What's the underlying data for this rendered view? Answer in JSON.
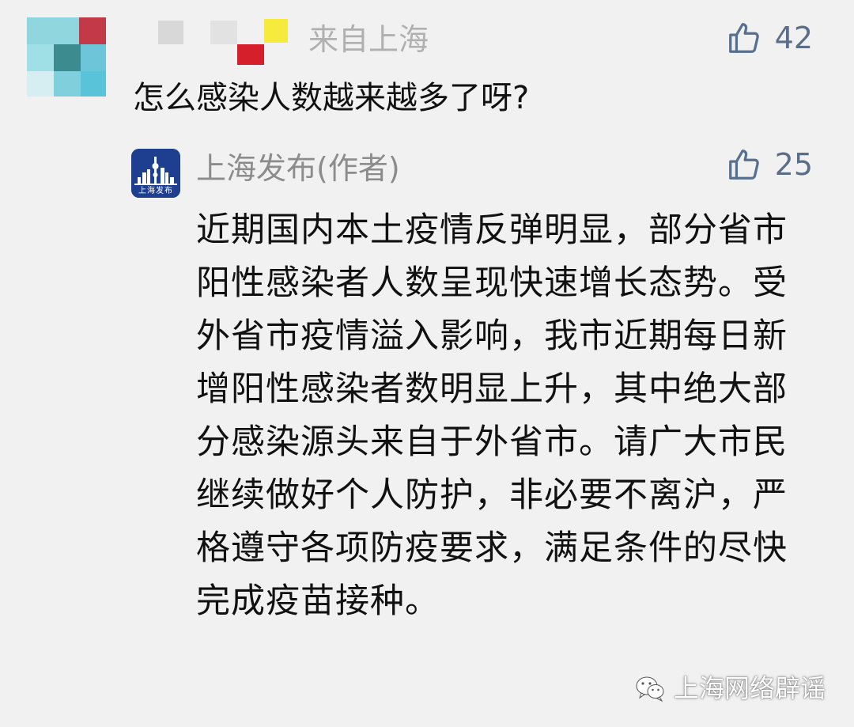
{
  "comment": {
    "location": "来自上海",
    "like_count": "42",
    "text": "怎么感染人数越来越多了呀?"
  },
  "reply": {
    "author": "上海发布(作者)",
    "avatar_text": "上海发布",
    "like_count": "25",
    "text": "近期国内本土疫情反弹明显，部分省市阳性感染者人数呈现快速增长态势。受外省市疫情溢入影响，我市近期每日新增阳性感染者数明显上升，其中绝大部分感染源头来自于外省市。请广大市民继续做好个人防护，非必要不离沪，严格遵守各项防疫要求，满足条件的尽快完成疫苗接种。"
  },
  "watermark": {
    "text": "上海网络辟谣"
  },
  "icons": {
    "like": "thumbs-up-icon",
    "watermark": "wechat-icon"
  },
  "colors": {
    "background": "#f1f1f1",
    "like_blue": "#58708f",
    "reply_avatar_blue": "#1e3f8f",
    "secondary_text": "#8c8c8c"
  }
}
